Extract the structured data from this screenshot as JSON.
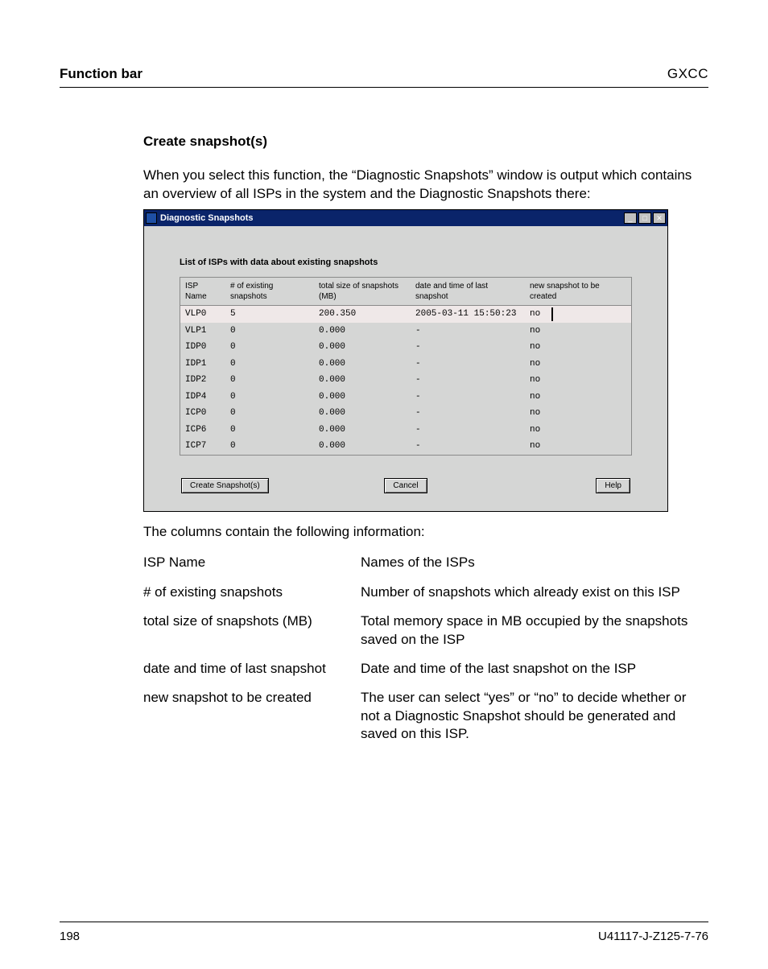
{
  "header": {
    "left": "Function bar",
    "right": "GXCC"
  },
  "section": {
    "title": "Create snapshot(s)",
    "intro": "When you select this function, the “Diagnostic Snapshots” window is output which contains an overview of all ISPs in the system and the Diagnostic Snapshots there:"
  },
  "window": {
    "title": "Diagnostic Snapshots",
    "winbtns": {
      "min": "_",
      "max": "□",
      "close": "✕"
    },
    "caption": "List of ISPs with data about existing snapshots",
    "columns": {
      "c1": "ISP Name",
      "c2": "# of existing snapshots",
      "c3": "total size of snapshots (MB)",
      "c4": "date and time of last snapshot",
      "cNew": "new snapshot to be created"
    },
    "rows": [
      {
        "c1": "VLP0",
        "c2": "5",
        "c3": "200.350",
        "c4": "2005-03-11 15:50:23",
        "c5": "no",
        "selected": true
      },
      {
        "c1": "VLP1",
        "c2": "0",
        "c3": "0.000",
        "c4": "-",
        "c5": "no",
        "selected": false
      },
      {
        "c1": "IDP0",
        "c2": "0",
        "c3": "0.000",
        "c4": "-",
        "c5": "no",
        "selected": false
      },
      {
        "c1": "IDP1",
        "c2": "0",
        "c3": "0.000",
        "c4": "-",
        "c5": "no",
        "selected": false
      },
      {
        "c1": "IDP2",
        "c2": "0",
        "c3": "0.000",
        "c4": "-",
        "c5": "no",
        "selected": false
      },
      {
        "c1": "IDP4",
        "c2": "0",
        "c3": "0.000",
        "c4": "-",
        "c5": "no",
        "selected": false
      },
      {
        "c1": "ICP0",
        "c2": "0",
        "c3": "0.000",
        "c4": "-",
        "c5": "no",
        "selected": false
      },
      {
        "c1": "ICP6",
        "c2": "0",
        "c3": "0.000",
        "c4": "-",
        "c5": "no",
        "selected": false
      },
      {
        "c1": "ICP7",
        "c2": "0",
        "c3": "0.000",
        "c4": "-",
        "c5": "no",
        "selected": false
      }
    ],
    "buttons": {
      "create": "Create Snapshot(s)",
      "cancel": "Cancel",
      "help": "Help"
    }
  },
  "afterShot": "The columns contain the following information:",
  "defs": [
    {
      "term": "ISP Name",
      "def": "Names of the ISPs"
    },
    {
      "term": "# of existing snapshots",
      "def": "Number of snapshots which already exist on this ISP"
    },
    {
      "term": "total size of snapshots (MB)",
      "def": "Total memory space in MB occupied by the snapshots saved on the ISP"
    },
    {
      "term": "date and time of last snapshot",
      "def": "Date and time of the last snapshot on the ISP"
    },
    {
      "term": "new snapshot to be created",
      "def": "The user can select “yes” or “no” to decide whether or not a Diagnostic Snapshot should be generated and saved on this ISP."
    }
  ],
  "footer": {
    "page": "198",
    "doc": "U41117-J-Z125-7-76"
  }
}
